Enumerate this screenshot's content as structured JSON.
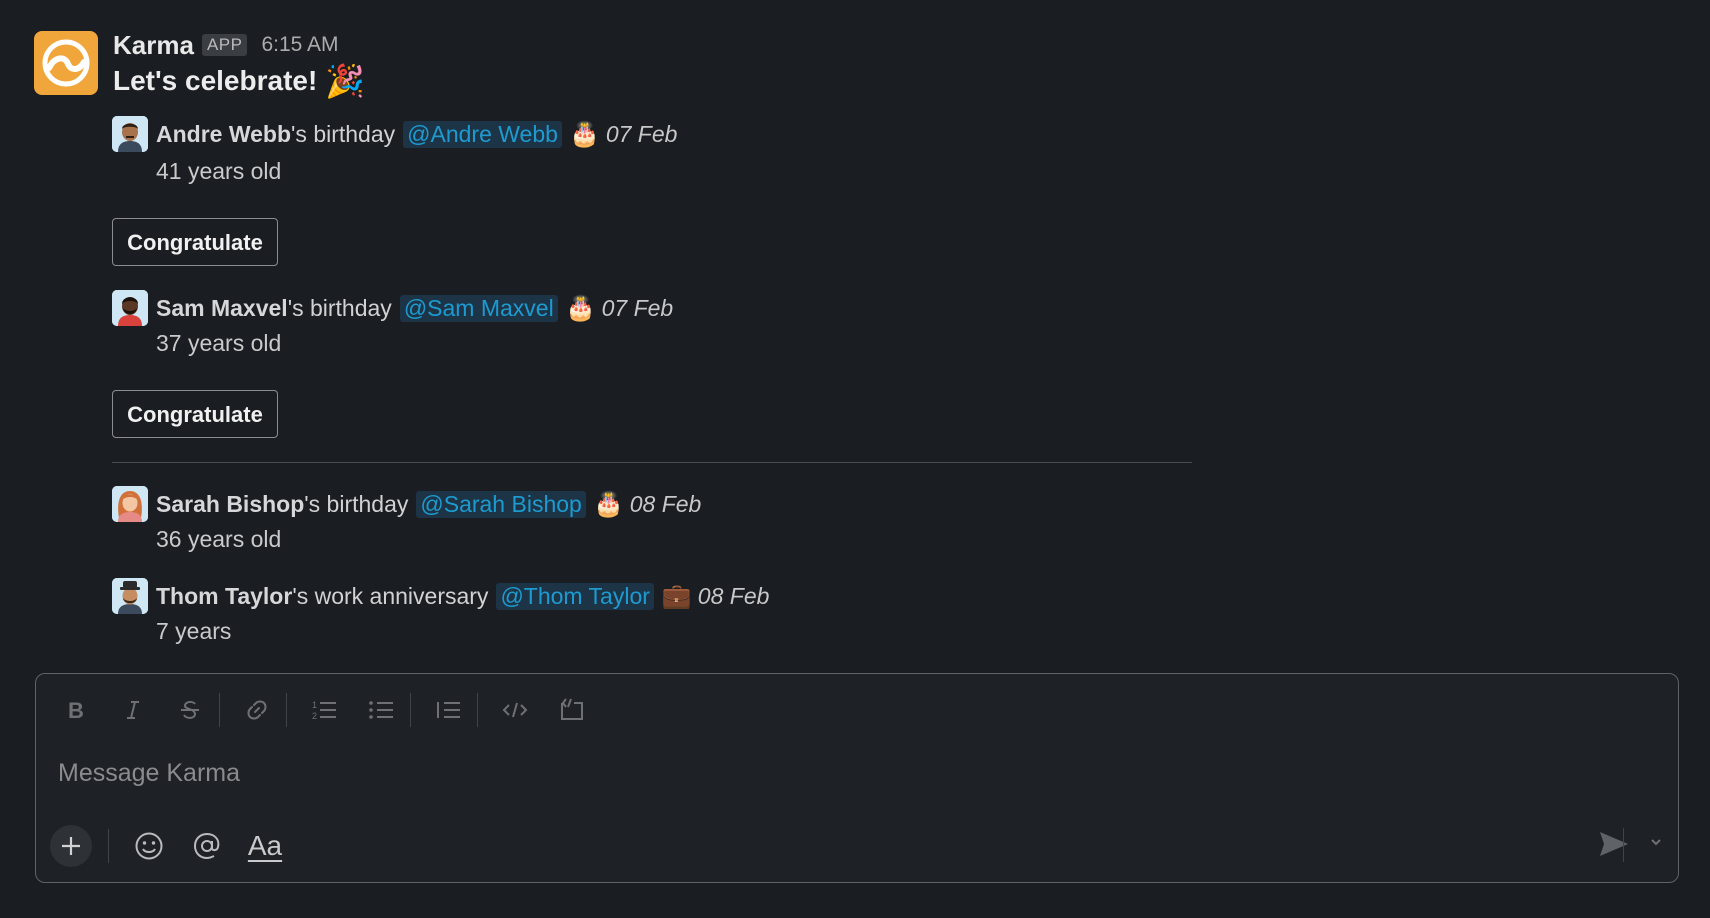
{
  "message": {
    "sender": "Karma",
    "badge": "APP",
    "time": "6:15 AM",
    "headline": "Let's celebrate!",
    "headline_emoji": "🎉"
  },
  "events": [
    {
      "name": "Andre Webb",
      "suffix": "'s birthday",
      "mention": "@Andre Webb",
      "emoji": "🎂",
      "date": "07 Feb",
      "detail": "41 years old",
      "button": "Congratulate"
    },
    {
      "name": "Sam Maxvel",
      "suffix": "'s birthday",
      "mention": "@Sam Maxvel",
      "emoji": "🎂",
      "date": "07 Feb",
      "detail": "37 years old",
      "button": "Congratulate"
    },
    {
      "name": "Sarah Bishop",
      "suffix": "'s birthday",
      "mention": "@Sarah Bishop",
      "emoji": "🎂",
      "date": "08 Feb",
      "detail": "36 years old"
    },
    {
      "name": "Thom Taylor",
      "suffix": "'s work anniversary",
      "mention": "@Thom Taylor",
      "emoji": "💼",
      "date": "08 Feb",
      "detail": "7 years"
    }
  ],
  "composer": {
    "placeholder": "Message Karma",
    "format_label": "Aa"
  },
  "colors": {
    "background": "#1a1d21",
    "mention_text": "#1d9bd1",
    "mention_bg": "#1d3446",
    "app_avatar": "#f0a63a"
  }
}
